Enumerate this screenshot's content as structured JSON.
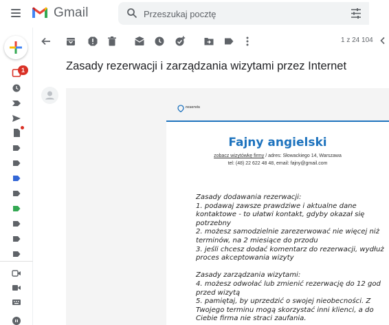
{
  "header": {
    "app_name": "Gmail",
    "search_placeholder": "Przeszukaj pocztę"
  },
  "rail": {
    "inbox_badge": "1"
  },
  "toolbar": {
    "count": "1 z 24 104"
  },
  "message": {
    "subject": "Zasady rezerwacji i zarządzania wizytami przez Internet"
  },
  "email": {
    "brand": "reservis",
    "company_name": "Fajny angielski",
    "company_link": "zobacz wizytówkę firmy",
    "company_address": " / adres: Słowackiego 14, Warszawa",
    "company_contact": "tel: (48) 22 622 48 48, email: fajny@gmail.com",
    "rules_lines": [
      "Zasady dodawania rezerwacji:",
      "1.  podawaj zawsze prawdziwe i aktualne dane",
      "kontaktowe - to ułatwi kontakt, gdyby okazał się",
      "potrzebny",
      "2. możesz samodzielnie zarezerwować nie więcej niż",
      "terminów, na 2 miesiące do przodu",
      "3. jeśli chcesz dodać komentarz do rezerwacji, wydłuż",
      "proces akceptowania wizyty",
      "",
      "Zasady zarządzania wizytami:",
      "4.  możesz odwołać lub zmienić rezerwację do 12 god",
      "przed wizytą",
      "5. pamiętaj, by uprzedzić o swojej nieobecności. Z",
      "Twojego terminu mogą skorzystać inni klienci, a do",
      "Ciebie firma nie straci zaufania."
    ]
  },
  "colors": {
    "brand_blue": "#1e73be",
    "badge_red": "#d93025"
  }
}
